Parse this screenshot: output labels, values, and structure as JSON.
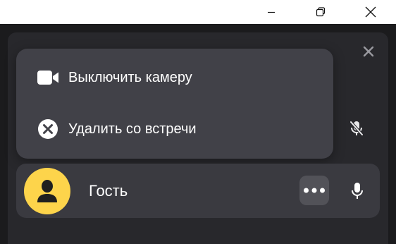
{
  "window_controls": {
    "minimize": "minimize-icon",
    "maximize": "restore-icon",
    "close": "close-icon"
  },
  "panel": {
    "close_icon": "close-icon"
  },
  "context_menu": {
    "items": [
      {
        "label": "Выключить камеру",
        "icon": "camera-icon"
      },
      {
        "label": "Удалить со встречи",
        "icon": "remove-circle-icon"
      }
    ]
  },
  "muted_mic_icon": "mic-off-icon",
  "participant": {
    "name": "Гость",
    "avatar_icon": "user-icon",
    "more_icon": "more-dots-icon",
    "mic_icon": "mic-icon"
  },
  "colors": {
    "background": "#1b1b1d",
    "panel": "#28282c",
    "menu": "#414148",
    "participant_row": "#3a3a40",
    "avatar": "#fdd44b",
    "text": "#ffffff"
  }
}
